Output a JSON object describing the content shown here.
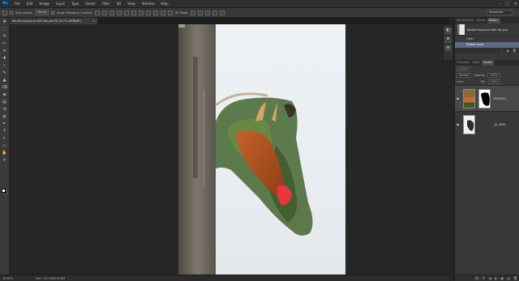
{
  "app": {
    "logo": "Ps"
  },
  "menu": [
    "File",
    "Edit",
    "Image",
    "Layer",
    "Type",
    "Select",
    "Filter",
    "3D",
    "View",
    "Window",
    "Help"
  ],
  "window_controls": [
    "–",
    "□",
    "×"
  ],
  "options_bar": {
    "auto_select_label": "Auto-Select:",
    "auto_select_value": "Group",
    "transform_label": "Show Transform Controls",
    "mode_label": "3D Mode:",
    "workspace": "Essentials"
  },
  "document_tab": {
    "title": "double exposure with fox.psd @ 16.7% (RGB/8*)",
    "close": "×"
  },
  "tools": [
    "✥",
    "⬚",
    "✎",
    "✂",
    "⌗",
    "✚",
    "✓",
    "✎",
    "▲",
    "⌫",
    "◈",
    "▤",
    "◔",
    "◍",
    "✒",
    "T",
    "↖",
    "▭",
    "✋",
    "⚲"
  ],
  "status": {
    "zoom": "16.67%",
    "doc_size": "Doc: 110.9M/110.6M"
  },
  "panel_strip_icons": [
    "◧",
    "❖",
    "⚙"
  ],
  "history_panel": {
    "tabs": [
      "Adjustments",
      "Styles",
      "History"
    ],
    "active_tab": "History",
    "snapshot_name": "double exposure with fox.psd",
    "steps": [
      "Open",
      "Delete Layer"
    ],
    "selected_step": "Delete Layer",
    "footer_icons": [
      "⬚",
      "◉",
      "🗑"
    ]
  },
  "layers_panel": {
    "tabs": [
      "Channels",
      "Paths",
      "Layers"
    ],
    "active_tab": "Layers",
    "kind_label": "ρ Kind",
    "blend_mode": "Normal",
    "opacity_label": "Opacity:",
    "opacity": "100%",
    "lock_label": "Lock:",
    "fill_label": "Fill:",
    "fill": "100%",
    "layers": [
      {
        "name": "5303761...",
        "visible": "◉",
        "selected": true
      },
      {
        "name": "_JIL_9861",
        "visible": "◉",
        "selected": false
      }
    ],
    "footer_icons": [
      "⛓",
      "fx",
      "◑",
      "◐",
      "▣",
      "▤",
      "🗑"
    ]
  },
  "colors": {
    "panel": "#383838",
    "workspace": "#262626",
    "selection": "#5a6b85",
    "comb": "#e8363f"
  }
}
